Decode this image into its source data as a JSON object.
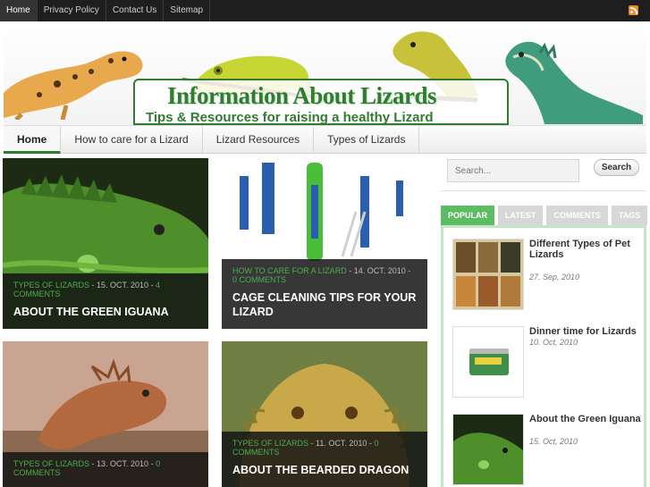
{
  "topnav": {
    "items": [
      {
        "label": "Home",
        "active": true
      },
      {
        "label": "Privacy Policy",
        "active": false
      },
      {
        "label": "Contact Us",
        "active": false
      },
      {
        "label": "Sitemap",
        "active": false
      }
    ],
    "rss_icon": "rss-icon"
  },
  "header": {
    "title": "Information About Lizards",
    "subtitle": "Tips & Resources for raising a healthy Lizard",
    "accent_color": "#2f7d2f"
  },
  "mainnav": {
    "items": [
      {
        "label": "Home",
        "active": true
      },
      {
        "label": "How to care for a Lizard",
        "active": false
      },
      {
        "label": "Lizard Resources",
        "active": false
      },
      {
        "label": "Types of Lizards",
        "active": false
      }
    ]
  },
  "posts": [
    {
      "category": "Types of Lizards",
      "date": "15. Oct. 2010",
      "comments": "4 Comments",
      "title": "About the Green Iguana"
    },
    {
      "category": "How to care for a Lizard",
      "date": "14. Oct. 2010",
      "comments": "0 Comments",
      "title": "Cage cleaning tips for your Lizard"
    },
    {
      "category": "Types of Lizards",
      "date": "13. Oct. 2010",
      "comments": "0 Comments",
      "title": ""
    },
    {
      "category": "Types of Lizards",
      "date": "11. Oct. 2010",
      "comments": "0 Comments",
      "title": "About the Bearded Dragon"
    }
  ],
  "search": {
    "placeholder": "Search...",
    "button_label": "Search"
  },
  "sidebar_tabs": {
    "tabs": [
      "Popular",
      "Latest",
      "Comments",
      "Tags"
    ],
    "active": "Popular",
    "items": [
      {
        "title": "Different Types of Pet Lizards",
        "date": "27. Sep, 2010"
      },
      {
        "title": "Dinner time for Lizards",
        "date": "10. Oct, 2010"
      },
      {
        "title": "About the Green Iguana",
        "date": "15. Oct, 2010"
      }
    ]
  }
}
